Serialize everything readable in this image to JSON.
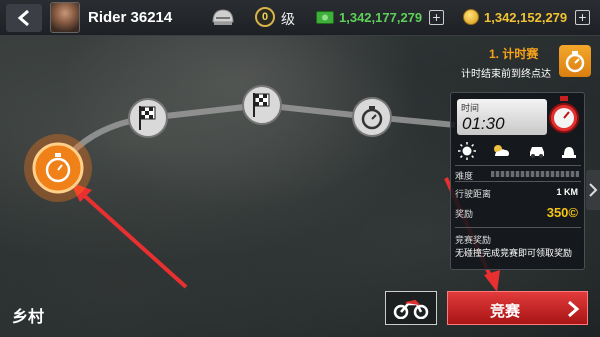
{
  "header": {
    "player_name": "Rider 36214",
    "level_value": "0",
    "level_label": "级",
    "cash": "1,342,177,279",
    "coins": "1,342,152,279"
  },
  "event": {
    "title": "1. 计时赛",
    "subtitle": "计时结束前到终点达"
  },
  "panel": {
    "time_label": "时间",
    "time_value": "01:30",
    "difficulty_label": "难度",
    "distance_label": "行驶距离",
    "distance_value": "1 KM",
    "reward_label": "奖励",
    "reward_value": "350©",
    "extra_label": "竞赛奖励",
    "extra_desc": "无碰撞完成竞赛即可领取奖励"
  },
  "footer": {
    "region": "乡村",
    "race_button": "竞赛"
  },
  "colors": {
    "accent_orange": "#f7a21b",
    "race_red": "#d42a2a",
    "cash_green": "#5fd05a",
    "coin_gold": "#f1c232"
  },
  "icons": [
    "back-icon",
    "avatar",
    "helmet-icon",
    "cash-icon",
    "coin-icon",
    "stopwatch-icon",
    "checkered-flag-icon",
    "sun-icon",
    "cloud-icon",
    "car-icon",
    "siren-icon",
    "motorcycle-icon",
    "chevron-right-icon"
  ]
}
